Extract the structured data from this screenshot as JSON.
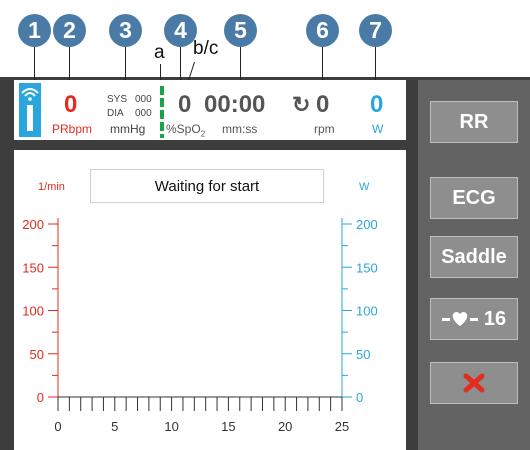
{
  "callouts": [
    "1",
    "2",
    "3",
    "4",
    "5",
    "6",
    "7"
  ],
  "letters": {
    "a": "a",
    "bc": "b/c"
  },
  "status": {
    "pr_value": "0",
    "pr_unit": "PRbpm",
    "sys_label": "SYS",
    "sys_value": "000",
    "dia_label": "DIA",
    "dia_value": "000",
    "bp_unit": "mmHg",
    "spo2_value": "0",
    "spo2_unit": "%SpO",
    "spo2_sub": "2",
    "time_value": "00:00",
    "time_unit": "mm:ss",
    "rpm_icon": "↻",
    "rpm_value": "0",
    "rpm_unit": "rpm",
    "watt_value": "0",
    "watt_unit": "W"
  },
  "chart": {
    "status_message": "Waiting for start",
    "left_unit": "1/min",
    "right_unit": "W"
  },
  "side_buttons": {
    "rr": "RR",
    "ecg": "ECG",
    "saddle": "Saddle",
    "heart_value": "16"
  },
  "colors": {
    "red": "#e32b1f",
    "blue": "#2aa6de",
    "gray": "#555555",
    "device": "#3d3d3d",
    "panel": "#636363",
    "button": "#8e8e8e"
  },
  "chart_data": {
    "type": "line",
    "x": [],
    "series": [],
    "xticks": [
      0,
      5,
      10,
      15,
      20,
      25
    ],
    "xlim": [
      0,
      25
    ],
    "left_yticks": [
      0,
      50,
      100,
      150,
      200
    ],
    "left_ylim": [
      0,
      200
    ],
    "right_yticks": [
      0,
      50,
      100,
      150,
      200
    ],
    "right_ylim": [
      0,
      200
    ],
    "left_ylabel": "1/min",
    "right_ylabel": "W",
    "title": "Waiting for start"
  }
}
